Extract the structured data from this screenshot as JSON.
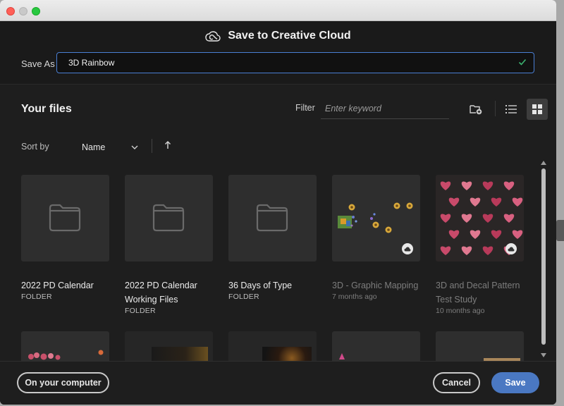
{
  "dialog": {
    "title": "Save to Creative Cloud",
    "save_as_label": "Save As",
    "save_as_value": "3D Rainbow"
  },
  "files": {
    "heading": "Your files",
    "filter_label": "Filter",
    "filter_placeholder": "Enter keyword",
    "sort_label": "Sort by",
    "sort_value": "Name",
    "view_mode": "grid",
    "items": [
      {
        "name": "2022 PD Calendar",
        "meta": "FOLDER",
        "kind": "folder"
      },
      {
        "name": "2022 PD Calendar Working Files",
        "meta": "FOLDER",
        "kind": "folder"
      },
      {
        "name": "36 Days of Type",
        "meta": "FOLDER",
        "kind": "folder"
      },
      {
        "name": "3D - Graphic Mapping",
        "meta": "7 months ago",
        "kind": "cloud-document"
      },
      {
        "name": "3D and Decal Pattern Test Study",
        "meta": "10 months ago",
        "kind": "cloud-document"
      }
    ]
  },
  "footer": {
    "on_computer_label": "On your computer",
    "cancel_label": "Cancel",
    "save_label": "Save"
  },
  "colors": {
    "accent": "#4a78c2",
    "input_border": "#4a7fd4",
    "check": "#3cb371",
    "background": "#1e1e1e"
  }
}
